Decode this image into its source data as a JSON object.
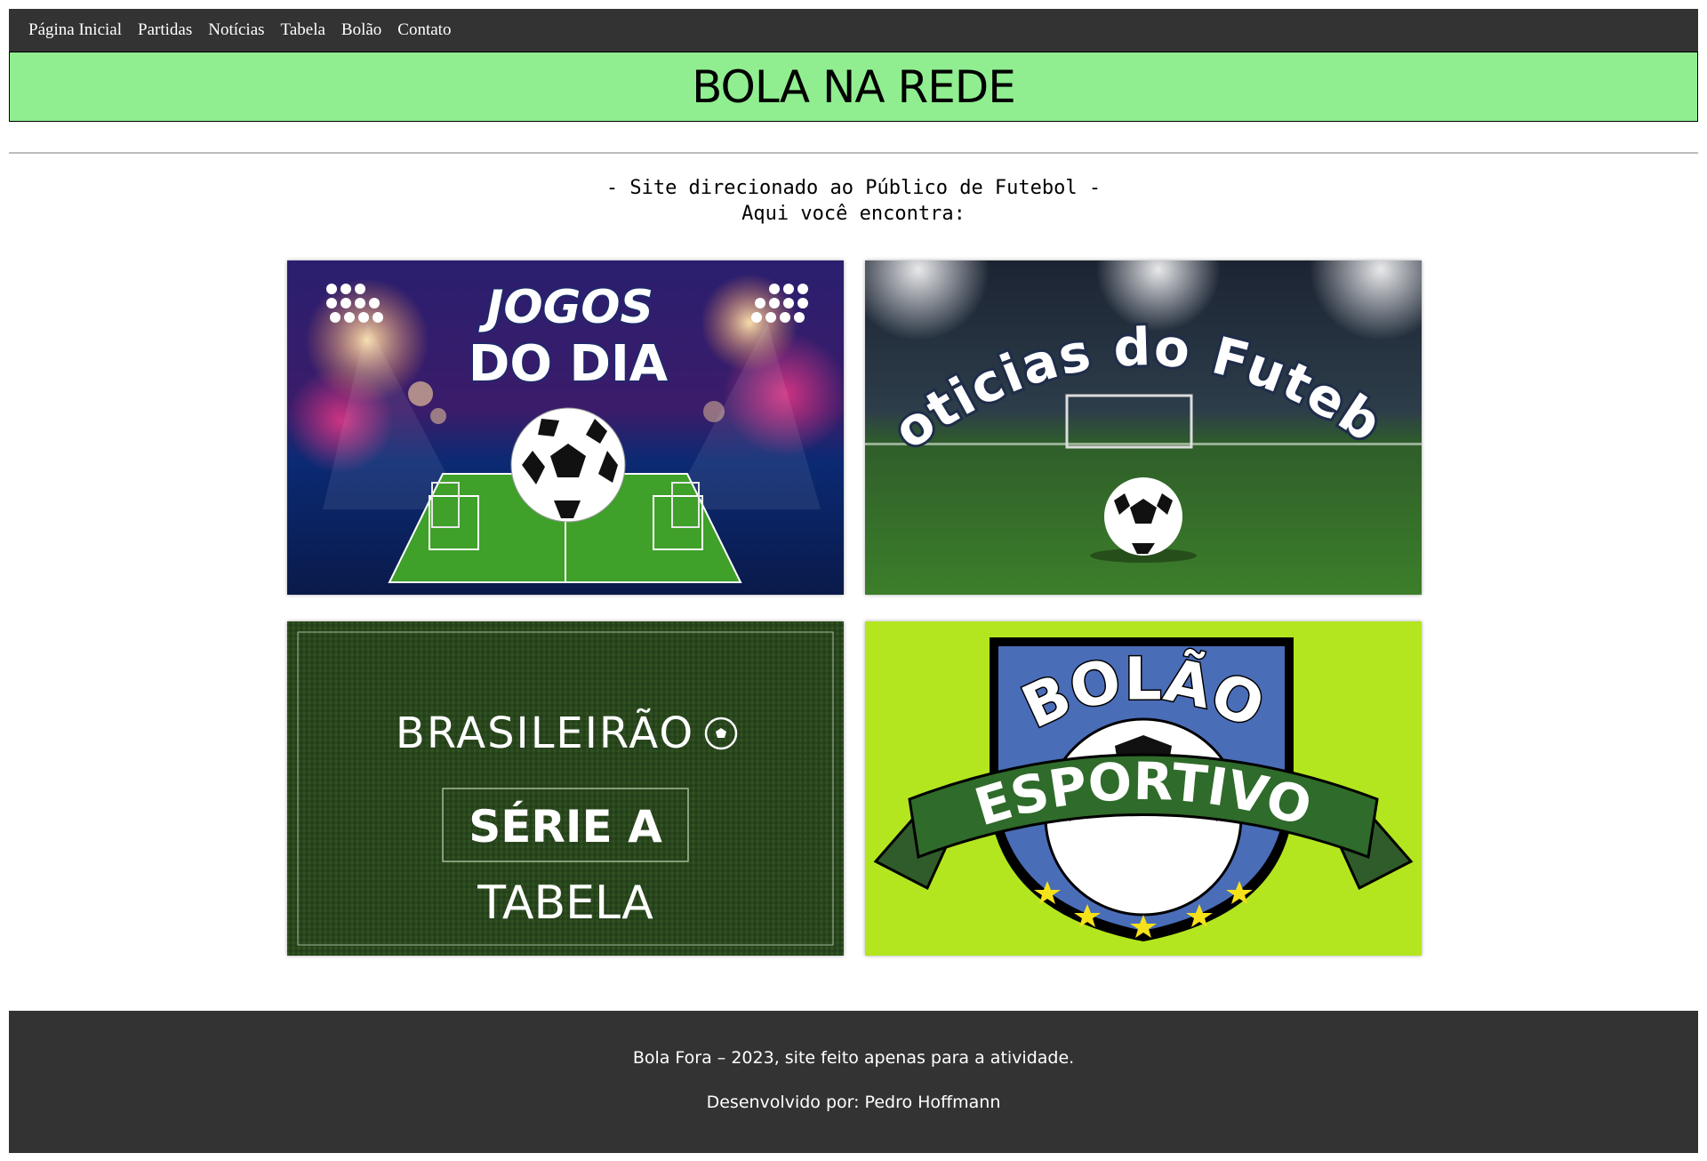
{
  "nav": {
    "items": [
      {
        "label": "Página Inicial"
      },
      {
        "label": "Partidas"
      },
      {
        "label": "Notícias"
      },
      {
        "label": "Tabela"
      },
      {
        "label": "Bolão"
      },
      {
        "label": "Contato"
      }
    ]
  },
  "banner": {
    "title": "BOLA NA REDE"
  },
  "intro": {
    "line1": "- Site direcionado ao Público de Futebol -",
    "line2": "Aqui você encontra:"
  },
  "cards": [
    {
      "line1": "JOGOS",
      "line2": "DO DIA"
    },
    {
      "title": "Noticias do Futebol"
    },
    {
      "line1": "BRASILEIRÃO",
      "line2": "SÉRIE A",
      "line3": "TABELA"
    },
    {
      "line1": "BOLÃO",
      "line2": "ESPORTIVO"
    }
  ],
  "footer": {
    "line1": "Bola Fora – 2023, site feito apenas para a atividade.",
    "line2": "Desenvolvido por: Pedro Hoffmann"
  },
  "colors": {
    "nav_bg": "#333333",
    "banner_bg": "#90ee90",
    "footer_bg": "#333333",
    "bolao_bg": "#b3e61f"
  }
}
